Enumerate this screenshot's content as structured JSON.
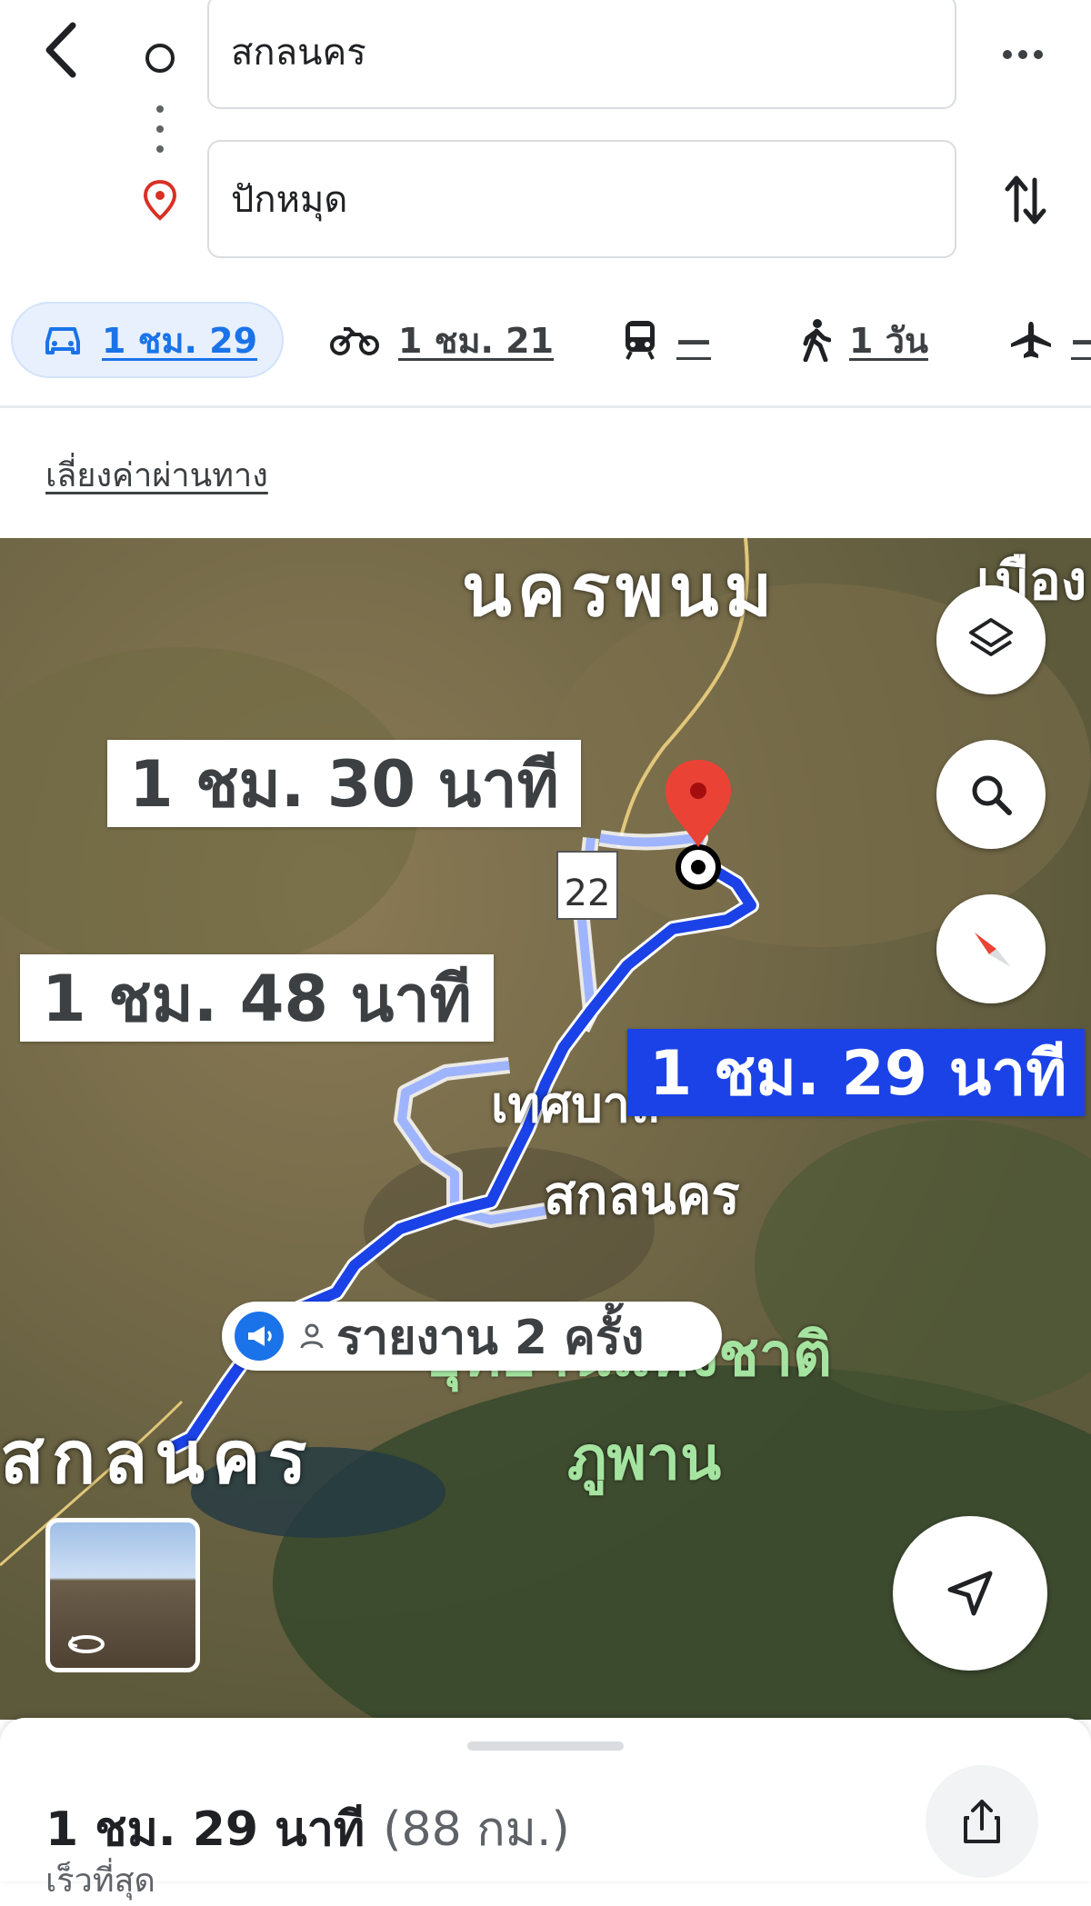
{
  "route": {
    "origin": "สกลนคร",
    "destination": "ปักหมุด"
  },
  "modes": {
    "car": "1 ชม. 29",
    "motorbike": "1 ชม. 21",
    "transit": "—",
    "walk": "1 วัน",
    "flight": "—"
  },
  "options": {
    "avoid_tolls": "เลี่ยงค่าผ่านทาง"
  },
  "map": {
    "label_nakhon_phanom": "นครพนม",
    "label_mueang": "เมือง",
    "label_municipality": "เทศบาล",
    "label_sakon": "สกลนคร",
    "label_park_line1": "อุทยานแห่งชาติ",
    "label_park_line2": "ภูพาน",
    "label_sakon_big": "สกลนคร",
    "alt_route_1": "1 ชม. 30 นาที",
    "alt_route_2": "1 ชม. 48 นาที",
    "main_route": "1 ชม. 29 นาที",
    "road_shield": "22",
    "reports": "รายงาน 2 ครั้ง",
    "colors": {
      "route": "#1a42e6",
      "alt_route": "#9fb4ff",
      "pin": "#ea4335"
    }
  },
  "summary": {
    "time": "1 ชม. 29 นาที",
    "distance": "(88 กม.)",
    "note": "เร็วที่สุด"
  }
}
